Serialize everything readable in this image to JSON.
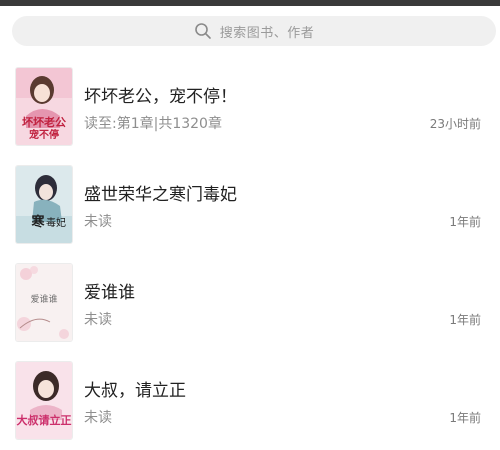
{
  "search": {
    "placeholder": "搜索图书、作者",
    "icon": "search-icon"
  },
  "books": [
    {
      "title": "坏坏老公，宠不停！",
      "progress": "读至:第1章|共1320章",
      "time": "23小时前",
      "cover_text": "坏坏老公宠不停",
      "cover_color": "#f3c9d6"
    },
    {
      "title": "盛世荣华之寒门毒妃",
      "progress": "未读",
      "time": "1年前",
      "cover_text": "寒门毒妃",
      "cover_color": "#cfe3e8"
    },
    {
      "title": "爱谁谁",
      "progress": "未读",
      "time": "1年前",
      "cover_text": "爱谁谁",
      "cover_color": "#f6eeee"
    },
    {
      "title": "大叔，请立正",
      "progress": "未读",
      "time": "1年前",
      "cover_text": "大叔请立正",
      "cover_color": "#f7dbe6"
    }
  ]
}
